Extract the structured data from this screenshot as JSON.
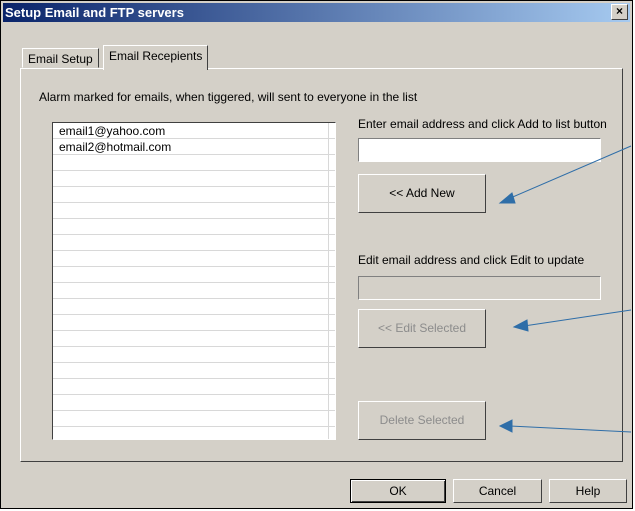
{
  "window": {
    "title": "Setup Email and FTP servers",
    "close_label": "×"
  },
  "tabs": [
    {
      "label": "Email Setup",
      "active": false
    },
    {
      "label": "Email Recepients",
      "active": true
    }
  ],
  "info_text": "Alarm marked for emails, when tiggered, will sent to everyone in the list",
  "recipients": [
    "email1@yahoo.com",
    "email2@hotmail.com"
  ],
  "add_section": {
    "label": "Enter email address and click Add to list button",
    "input_value": "",
    "button_label": "<< Add New"
  },
  "edit_section": {
    "label": "Edit email address and click Edit to update",
    "input_value": "",
    "button_label": "<< Edit Selected"
  },
  "delete_button_label": "Delete Selected",
  "footer": {
    "ok": "OK",
    "cancel": "Cancel",
    "help": "Help"
  },
  "colors": {
    "dialog_bg": "#d4d0c8",
    "title_start": "#0a246a",
    "title_end": "#a6caf0",
    "arrow": "#2f6ea8"
  }
}
